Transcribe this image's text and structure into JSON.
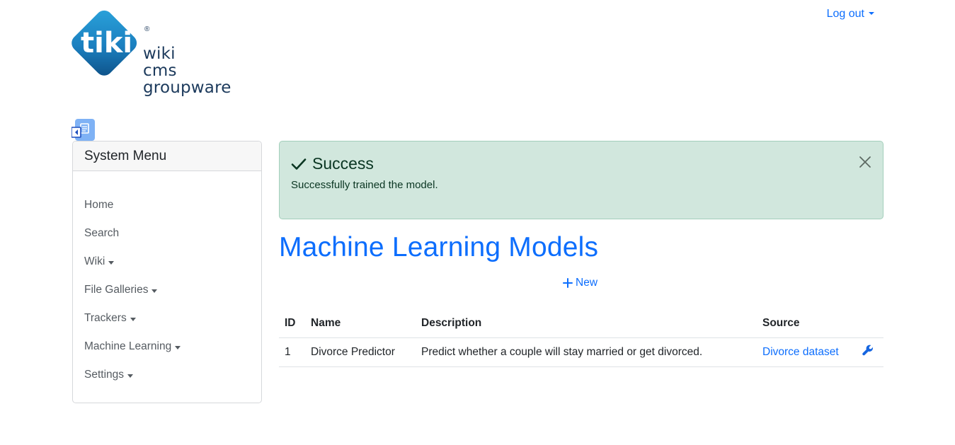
{
  "header": {
    "logo": {
      "mark_text": "tiki",
      "registered": "®",
      "words": [
        "wiki",
        "cms",
        "groupware"
      ]
    },
    "logout_label": "Log out"
  },
  "icons": {
    "menu_toggle": "sidebar-toggle-icon",
    "logout_caret": "caret-down-icon",
    "success": "check-icon",
    "close": "close-icon",
    "new": "plus-icon",
    "actions": "wrench-icon"
  },
  "sidebar": {
    "title": "System Menu",
    "items": [
      {
        "label": "Home",
        "dropdown": false
      },
      {
        "label": "Search",
        "dropdown": false
      },
      {
        "label": "Wiki",
        "dropdown": true
      },
      {
        "label": "File Galleries",
        "dropdown": true
      },
      {
        "label": "Trackers",
        "dropdown": true
      },
      {
        "label": "Machine Learning",
        "dropdown": true
      },
      {
        "label": "Settings",
        "dropdown": true
      }
    ]
  },
  "alert": {
    "title": "Success",
    "message": "Successfully trained the model."
  },
  "main": {
    "title": "Machine Learning Models",
    "new_label": "New",
    "table": {
      "headers": {
        "id": "ID",
        "name": "Name",
        "description": "Description",
        "source": "Source"
      },
      "rows": [
        {
          "id": "1",
          "name": "Divorce Predictor",
          "description": "Predict whether a couple will stay married or get divorced.",
          "source": "Divorce dataset"
        }
      ]
    }
  },
  "colors": {
    "link": "#0d6efd",
    "alert_bg": "#d1e7dd",
    "alert_text": "#0a3622",
    "logo_blue": "#1b7fbf",
    "logo_text": "#1c3a5c"
  }
}
